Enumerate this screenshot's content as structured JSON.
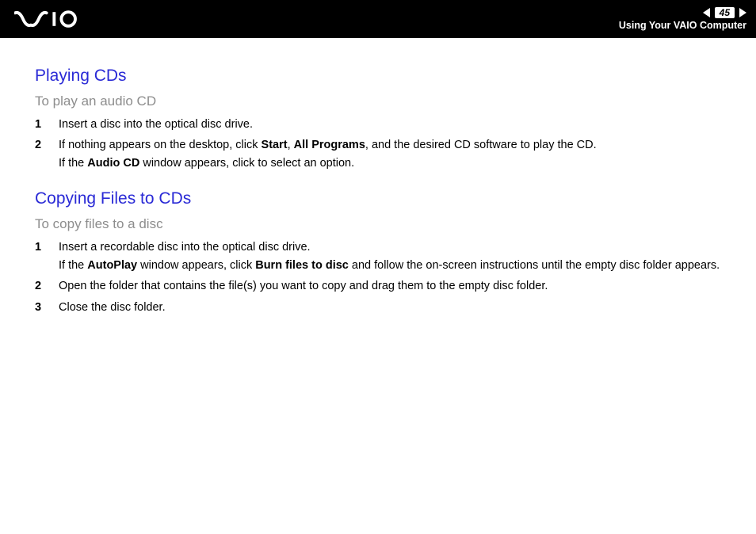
{
  "header": {
    "page_number": "45",
    "subtitle": "Using Your VAIO Computer"
  },
  "section1": {
    "title": "Playing CDs",
    "subtitle": "To play an audio CD",
    "step1": "Insert a disc into the optical disc drive.",
    "step2_a": "If nothing appears on the desktop, click ",
    "step2_b1": "Start",
    "step2_c": ", ",
    "step2_b2": "All Programs",
    "step2_d": ", and the desired CD software to play the CD.",
    "step2_e": "If the ",
    "step2_b3": "Audio CD",
    "step2_f": " window appears, click to select an option."
  },
  "section2": {
    "title": "Copying Files to CDs",
    "subtitle": "To copy files to a disc",
    "step1_a": "Insert a recordable disc into the optical disc drive.",
    "step1_b": "If the ",
    "step1_bold1": "AutoPlay",
    "step1_c": " window appears, click ",
    "step1_bold2": "Burn files to disc",
    "step1_d": " and follow the on-screen instructions until the empty disc folder appears.",
    "step2": "Open the folder that contains the file(s) you want to copy and drag them to the empty disc folder.",
    "step3": "Close the disc folder."
  }
}
